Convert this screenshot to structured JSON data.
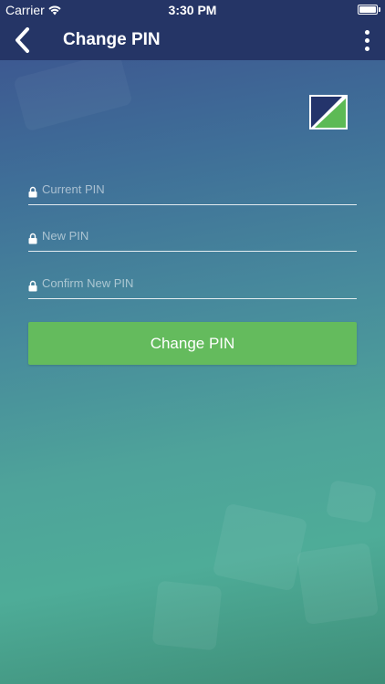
{
  "status_bar": {
    "carrier": "Carrier",
    "time": "3:30 PM",
    "battery_level": 1.0
  },
  "nav": {
    "title": "Change PIN",
    "back_icon": "chevron-left-icon",
    "menu_icon": "more-vertical-icon"
  },
  "form": {
    "current_pin_placeholder": "Current PIN",
    "new_pin_placeholder": "New PIN",
    "confirm_pin_placeholder": "Confirm New PIN",
    "submit_label": "Change PIN"
  },
  "colors": {
    "nav_background": "#253566",
    "button_green": "#64bb5d",
    "logo_navy": "#24346b",
    "logo_green": "#5dba55"
  }
}
